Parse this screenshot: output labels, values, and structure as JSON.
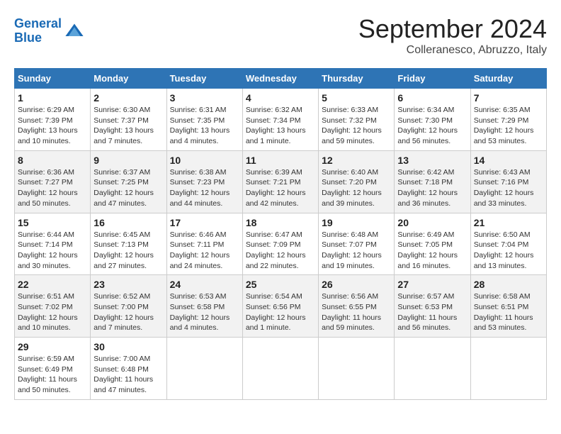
{
  "header": {
    "logo_line1": "General",
    "logo_line2": "Blue",
    "month": "September 2024",
    "location": "Colleranesco, Abruzzo, Italy"
  },
  "weekdays": [
    "Sunday",
    "Monday",
    "Tuesday",
    "Wednesday",
    "Thursday",
    "Friday",
    "Saturday"
  ],
  "weeks": [
    [
      {
        "day": "1",
        "sunrise": "6:29 AM",
        "sunset": "7:39 PM",
        "daylight": "13 hours and 10 minutes."
      },
      {
        "day": "2",
        "sunrise": "6:30 AM",
        "sunset": "7:37 PM",
        "daylight": "13 hours and 7 minutes."
      },
      {
        "day": "3",
        "sunrise": "6:31 AM",
        "sunset": "7:35 PM",
        "daylight": "13 hours and 4 minutes."
      },
      {
        "day": "4",
        "sunrise": "6:32 AM",
        "sunset": "7:34 PM",
        "daylight": "13 hours and 1 minute."
      },
      {
        "day": "5",
        "sunrise": "6:33 AM",
        "sunset": "7:32 PM",
        "daylight": "12 hours and 59 minutes."
      },
      {
        "day": "6",
        "sunrise": "6:34 AM",
        "sunset": "7:30 PM",
        "daylight": "12 hours and 56 minutes."
      },
      {
        "day": "7",
        "sunrise": "6:35 AM",
        "sunset": "7:29 PM",
        "daylight": "12 hours and 53 minutes."
      }
    ],
    [
      {
        "day": "8",
        "sunrise": "6:36 AM",
        "sunset": "7:27 PM",
        "daylight": "12 hours and 50 minutes."
      },
      {
        "day": "9",
        "sunrise": "6:37 AM",
        "sunset": "7:25 PM",
        "daylight": "12 hours and 47 minutes."
      },
      {
        "day": "10",
        "sunrise": "6:38 AM",
        "sunset": "7:23 PM",
        "daylight": "12 hours and 44 minutes."
      },
      {
        "day": "11",
        "sunrise": "6:39 AM",
        "sunset": "7:21 PM",
        "daylight": "12 hours and 42 minutes."
      },
      {
        "day": "12",
        "sunrise": "6:40 AM",
        "sunset": "7:20 PM",
        "daylight": "12 hours and 39 minutes."
      },
      {
        "day": "13",
        "sunrise": "6:42 AM",
        "sunset": "7:18 PM",
        "daylight": "12 hours and 36 minutes."
      },
      {
        "day": "14",
        "sunrise": "6:43 AM",
        "sunset": "7:16 PM",
        "daylight": "12 hours and 33 minutes."
      }
    ],
    [
      {
        "day": "15",
        "sunrise": "6:44 AM",
        "sunset": "7:14 PM",
        "daylight": "12 hours and 30 minutes."
      },
      {
        "day": "16",
        "sunrise": "6:45 AM",
        "sunset": "7:13 PM",
        "daylight": "12 hours and 27 minutes."
      },
      {
        "day": "17",
        "sunrise": "6:46 AM",
        "sunset": "7:11 PM",
        "daylight": "12 hours and 24 minutes."
      },
      {
        "day": "18",
        "sunrise": "6:47 AM",
        "sunset": "7:09 PM",
        "daylight": "12 hours and 22 minutes."
      },
      {
        "day": "19",
        "sunrise": "6:48 AM",
        "sunset": "7:07 PM",
        "daylight": "12 hours and 19 minutes."
      },
      {
        "day": "20",
        "sunrise": "6:49 AM",
        "sunset": "7:05 PM",
        "daylight": "12 hours and 16 minutes."
      },
      {
        "day": "21",
        "sunrise": "6:50 AM",
        "sunset": "7:04 PM",
        "daylight": "12 hours and 13 minutes."
      }
    ],
    [
      {
        "day": "22",
        "sunrise": "6:51 AM",
        "sunset": "7:02 PM",
        "daylight": "12 hours and 10 minutes."
      },
      {
        "day": "23",
        "sunrise": "6:52 AM",
        "sunset": "7:00 PM",
        "daylight": "12 hours and 7 minutes."
      },
      {
        "day": "24",
        "sunrise": "6:53 AM",
        "sunset": "6:58 PM",
        "daylight": "12 hours and 4 minutes."
      },
      {
        "day": "25",
        "sunrise": "6:54 AM",
        "sunset": "6:56 PM",
        "daylight": "12 hours and 1 minute."
      },
      {
        "day": "26",
        "sunrise": "6:56 AM",
        "sunset": "6:55 PM",
        "daylight": "11 hours and 59 minutes."
      },
      {
        "day": "27",
        "sunrise": "6:57 AM",
        "sunset": "6:53 PM",
        "daylight": "11 hours and 56 minutes."
      },
      {
        "day": "28",
        "sunrise": "6:58 AM",
        "sunset": "6:51 PM",
        "daylight": "11 hours and 53 minutes."
      }
    ],
    [
      {
        "day": "29",
        "sunrise": "6:59 AM",
        "sunset": "6:49 PM",
        "daylight": "11 hours and 50 minutes."
      },
      {
        "day": "30",
        "sunrise": "7:00 AM",
        "sunset": "6:48 PM",
        "daylight": "11 hours and 47 minutes."
      },
      null,
      null,
      null,
      null,
      null
    ]
  ]
}
